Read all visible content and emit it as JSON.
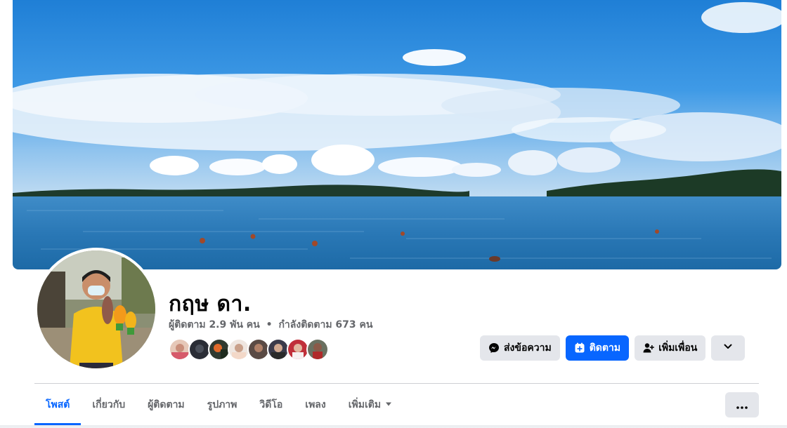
{
  "profile": {
    "name": "กฤษ ดา.",
    "followers": "ผู้ติดตาม 2.9 พัน คน",
    "separator": "•",
    "following": "กำลังติดตาม 673 คน"
  },
  "actions": {
    "message_label": "ส่งข้อความ",
    "follow_label": "ติดตาม",
    "add_friend_label": "เพิ่มเพื่อน"
  },
  "tabs": [
    {
      "label": "โพสต์",
      "active": true
    },
    {
      "label": "เกี่ยวกับ"
    },
    {
      "label": "ผู้ติดตาม"
    },
    {
      "label": "รูปภาพ"
    },
    {
      "label": "วิดีโอ"
    },
    {
      "label": "เพลง"
    },
    {
      "label": "เพิ่มเติม"
    }
  ],
  "colors": {
    "accent": "#0866ff",
    "button_gray": "#e4e6eb",
    "secondary_text": "#65676b"
  },
  "icons": [
    "messenger-icon",
    "follow-icon",
    "add-friend-icon",
    "chevron-down-icon",
    "caret-down-icon",
    "more-dots-icon"
  ]
}
